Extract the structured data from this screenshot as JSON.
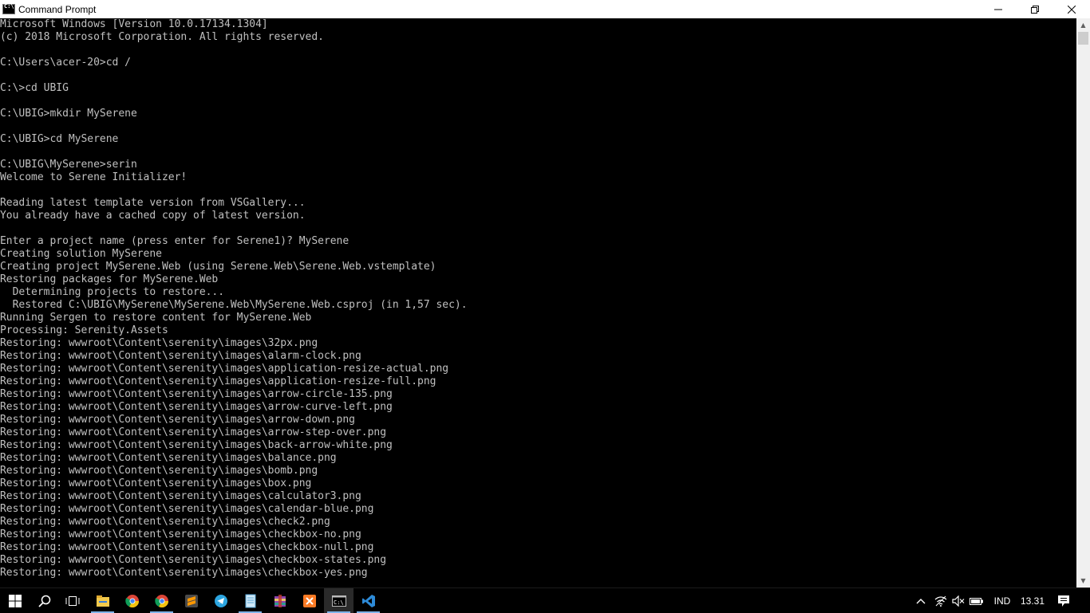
{
  "window": {
    "title": "Command Prompt",
    "minimize_glyph": "minimize-icon",
    "maximize_glyph": "restore-icon",
    "close_glyph": "close-icon"
  },
  "console": {
    "lines": [
      "Microsoft Windows [Version 10.0.17134.1304]",
      "(c) 2018 Microsoft Corporation. All rights reserved.",
      "",
      "C:\\Users\\acer-20>cd /",
      "",
      "C:\\>cd UBIG",
      "",
      "C:\\UBIG>mkdir MySerene",
      "",
      "C:\\UBIG>cd MySerene",
      "",
      "C:\\UBIG\\MySerene>serin",
      "Welcome to Serene Initializer!",
      "",
      "Reading latest template version from VSGallery...",
      "You already have a cached copy of latest version.",
      "",
      "Enter a project name (press enter for Serene1)? MySerene",
      "Creating solution MySerene",
      "Creating project MySerene.Web (using Serene.Web\\Serene.Web.vstemplate)",
      "Restoring packages for MySerene.Web",
      "  Determining projects to restore...",
      "  Restored C:\\UBIG\\MySerene\\MySerene.Web\\MySerene.Web.csproj (in 1,57 sec).",
      "Running Sergen to restore content for MySerene.Web",
      "Processing: Serenity.Assets",
      "Restoring: wwwroot\\Content\\serenity\\images\\32px.png",
      "Restoring: wwwroot\\Content\\serenity\\images\\alarm-clock.png",
      "Restoring: wwwroot\\Content\\serenity\\images\\application-resize-actual.png",
      "Restoring: wwwroot\\Content\\serenity\\images\\application-resize-full.png",
      "Restoring: wwwroot\\Content\\serenity\\images\\arrow-circle-135.png",
      "Restoring: wwwroot\\Content\\serenity\\images\\arrow-curve-left.png",
      "Restoring: wwwroot\\Content\\serenity\\images\\arrow-down.png",
      "Restoring: wwwroot\\Content\\serenity\\images\\arrow-step-over.png",
      "Restoring: wwwroot\\Content\\serenity\\images\\back-arrow-white.png",
      "Restoring: wwwroot\\Content\\serenity\\images\\balance.png",
      "Restoring: wwwroot\\Content\\serenity\\images\\bomb.png",
      "Restoring: wwwroot\\Content\\serenity\\images\\box.png",
      "Restoring: wwwroot\\Content\\serenity\\images\\calculator3.png",
      "Restoring: wwwroot\\Content\\serenity\\images\\calendar-blue.png",
      "Restoring: wwwroot\\Content\\serenity\\images\\check2.png",
      "Restoring: wwwroot\\Content\\serenity\\images\\checkbox-no.png",
      "Restoring: wwwroot\\Content\\serenity\\images\\checkbox-null.png",
      "Restoring: wwwroot\\Content\\serenity\\images\\checkbox-states.png",
      "Restoring: wwwroot\\Content\\serenity\\images\\checkbox-yes.png"
    ]
  },
  "taskbar": {
    "pinned": [
      {
        "icon": "start-windows-icon"
      },
      {
        "icon": "search-icon"
      },
      {
        "icon": "task-view-icon"
      },
      {
        "icon": "file-explorer-icon"
      },
      {
        "icon": "chrome-icon"
      },
      {
        "icon": "chrome-icon"
      },
      {
        "icon": "sublime-text-icon"
      },
      {
        "icon": "telegram-icon"
      },
      {
        "icon": "notepad-icon"
      },
      {
        "icon": "winrar-icon"
      },
      {
        "icon": "xampp-icon"
      },
      {
        "icon": "command-prompt-icon"
      },
      {
        "icon": "vscode-icon"
      }
    ],
    "tray": {
      "language": "IND",
      "time": "13.31"
    }
  },
  "colors": {
    "console_bg": "#000000",
    "console_fg": "#c0c0c0",
    "taskbar_bg": "#000000",
    "active_underline": "#7eb4ea",
    "vscode_blue": "#2d8ad7"
  }
}
